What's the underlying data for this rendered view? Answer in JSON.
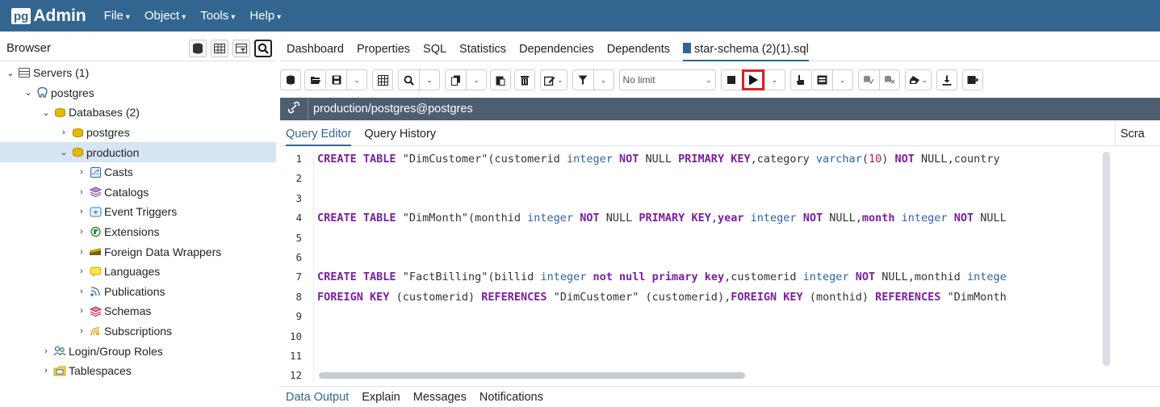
{
  "app": {
    "logo_pg": "pg",
    "logo_admin": "Admin"
  },
  "menu": [
    {
      "label": "File"
    },
    {
      "label": "Object"
    },
    {
      "label": "Tools"
    },
    {
      "label": "Help"
    }
  ],
  "browser": {
    "title": "Browser",
    "tree": [
      {
        "label": "Servers (1)",
        "level": 0,
        "caret": "down",
        "icon": "server-group-icon"
      },
      {
        "label": "postgres",
        "level": 1,
        "caret": "down",
        "icon": "elephant-icon"
      },
      {
        "label": "Databases (2)",
        "level": 2,
        "caret": "down",
        "icon": "database-icon"
      },
      {
        "label": "postgres",
        "level": 3,
        "caret": "right",
        "icon": "database-icon"
      },
      {
        "label": "production",
        "level": 3,
        "caret": "down",
        "icon": "database-icon",
        "selected": true
      },
      {
        "label": "Casts",
        "level": 4,
        "caret": "right",
        "icon": "casts-icon"
      },
      {
        "label": "Catalogs",
        "level": 4,
        "caret": "right",
        "icon": "catalogs-icon"
      },
      {
        "label": "Event Triggers",
        "level": 4,
        "caret": "right",
        "icon": "event-triggers-icon"
      },
      {
        "label": "Extensions",
        "level": 4,
        "caret": "right",
        "icon": "extensions-icon"
      },
      {
        "label": "Foreign Data Wrappers",
        "level": 4,
        "caret": "right",
        "icon": "foreign-data-wrappers-icon"
      },
      {
        "label": "Languages",
        "level": 4,
        "caret": "right",
        "icon": "languages-icon"
      },
      {
        "label": "Publications",
        "level": 4,
        "caret": "right",
        "icon": "publications-icon"
      },
      {
        "label": "Schemas",
        "level": 4,
        "caret": "right",
        "icon": "schemas-icon"
      },
      {
        "label": "Subscriptions",
        "level": 4,
        "caret": "right",
        "icon": "subscriptions-icon"
      },
      {
        "label": "Login/Group Roles",
        "level": 1,
        "caret": "right",
        "icon": "login-roles-icon"
      },
      {
        "label": "Tablespaces",
        "level": 1,
        "caret": "right",
        "icon": "tablespaces-icon"
      }
    ]
  },
  "tabs": [
    {
      "label": "Dashboard"
    },
    {
      "label": "Properties"
    },
    {
      "label": "SQL"
    },
    {
      "label": "Statistics"
    },
    {
      "label": "Dependencies"
    },
    {
      "label": "Dependents"
    },
    {
      "label": "star-schema (2)(1).sql",
      "active": true
    }
  ],
  "toolbar": {
    "limit_label": "No limit"
  },
  "connection": {
    "label": "production/postgres@postgres"
  },
  "query_tabs": {
    "editor": "Query Editor",
    "history": "Query History",
    "scratch": "Scra"
  },
  "editor": {
    "line_numbers": [
      "1",
      "2",
      "3",
      "4",
      "5",
      "6",
      "7",
      "8",
      "9",
      "10",
      "11",
      "12"
    ],
    "lines": [
      "CREATE TABLE \"DimCustomer\"(customerid integer NOT NULL PRIMARY KEY,category varchar(10) NOT NULL,country",
      "",
      "",
      "CREATE TABLE \"DimMonth\"(monthid integer NOT NULL PRIMARY KEY,year integer NOT NULL,month integer NOT NULL",
      "",
      "",
      "CREATE TABLE \"FactBilling\"(billid integer not null primary key,customerid integer NOT NULL,monthid intege",
      "FOREIGN KEY (customerid) REFERENCES \"DimCustomer\" (customerid),FOREIGN KEY (monthid) REFERENCES \"DimMonth",
      "",
      "",
      "",
      ""
    ]
  },
  "bottom_tabs": [
    {
      "label": "Data Output",
      "active": true
    },
    {
      "label": "Explain"
    },
    {
      "label": "Messages"
    },
    {
      "label": "Notifications"
    }
  ]
}
